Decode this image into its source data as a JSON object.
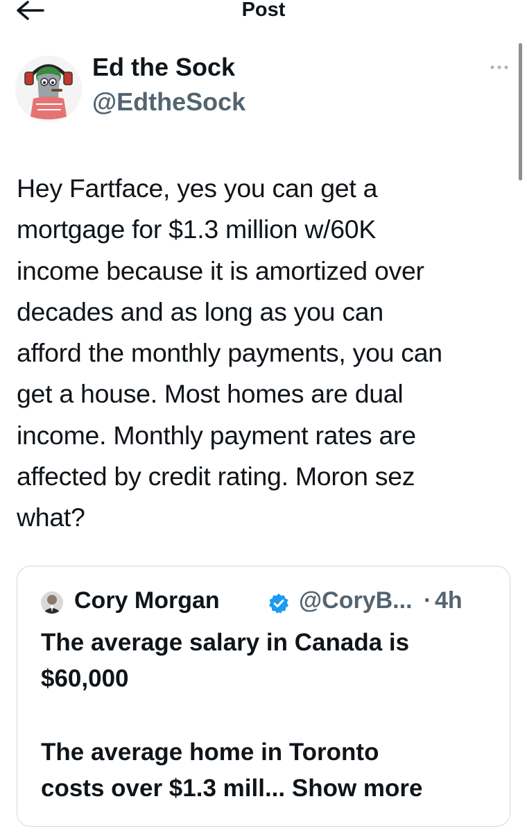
{
  "header": {
    "title": "Post"
  },
  "author": {
    "name": "Ed the Sock",
    "handle": "@EdtheSock"
  },
  "post": {
    "text": "Hey Fartface, yes you can get a\nmortgage for $1.3 million w/60K\nincome because it is amortized over\ndecades and as long as you can\nafford the monthly payments, you can\nget a house.  Most homes are dual\nincome. Monthly payment rates are\naffected by credit rating. Moron sez\nwhat?"
  },
  "quote": {
    "name": "Cory Morgan",
    "handle": "@CoryB...",
    "dot": "·",
    "time": "4h",
    "text_part1": "The average salary in Canada is\n$60,000",
    "text_part2_line1": "The average home in Toronto",
    "text_part2_line2": "costs over $1.3 mill... Show more"
  },
  "icons": {
    "back": "arrow-left-icon",
    "more": "more-dots-icon",
    "verified": "verified-badge-icon"
  },
  "colors": {
    "verified": "#1d9bf0",
    "secondary_text": "#536471"
  }
}
